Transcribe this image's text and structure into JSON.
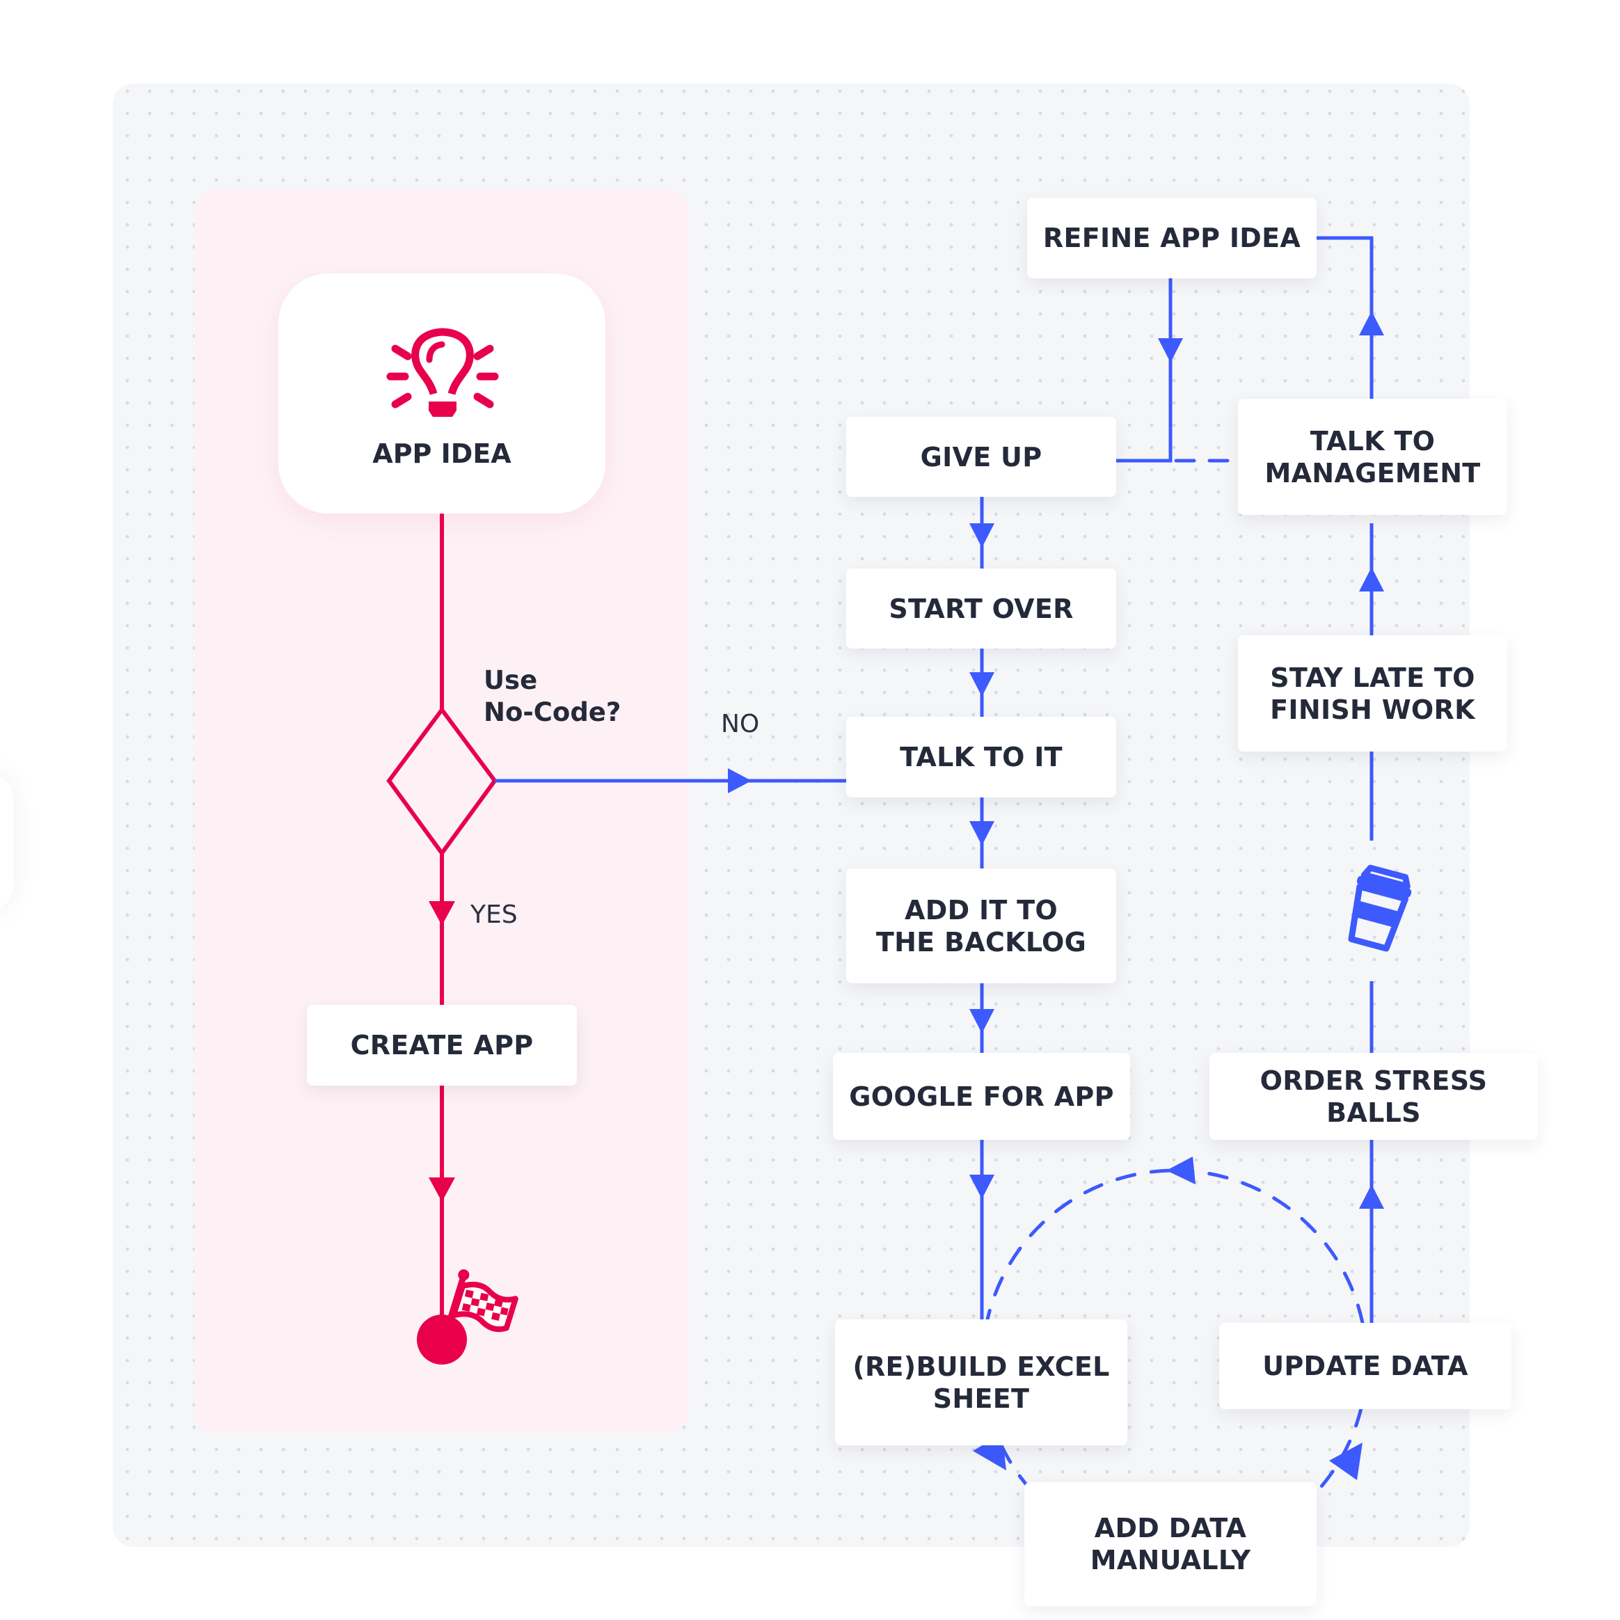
{
  "colors": {
    "primary_flow": "#e8004c",
    "alt_flow": "#3d5afe",
    "text": "#252a3a",
    "canvas": "#f5f6f8",
    "lane": "#fdf1f5"
  },
  "start": {
    "label": "APP IDEA",
    "icon": "lightbulb-icon"
  },
  "decision": {
    "question": "Use\nNo-Code?",
    "yes_label": "YES",
    "no_label": "NO"
  },
  "success_path": {
    "create": "CREATE APP",
    "end_icon": "checkered-flag-icon"
  },
  "nodes": {
    "refine": "REFINE APP IDEA",
    "give_up": "GIVE UP",
    "talk_mgmt": "TALK TO\nMANAGEMENT",
    "start_over": "START OVER",
    "stay_late": "STAY LATE TO\nFINISH WORK",
    "talk_it": "TALK TO IT",
    "backlog": "ADD IT TO\nTHE BACKLOG",
    "google": "GOOGLE FOR APP",
    "stress": "ORDER STRESS BALLS",
    "rebuild": "(RE)BUILD EXCEL\nSHEET",
    "update": "UPDATE DATA",
    "add_manual": "ADD DATA\nMANUALLY"
  },
  "decor": {
    "coffee": "coffee-cup-icon"
  }
}
